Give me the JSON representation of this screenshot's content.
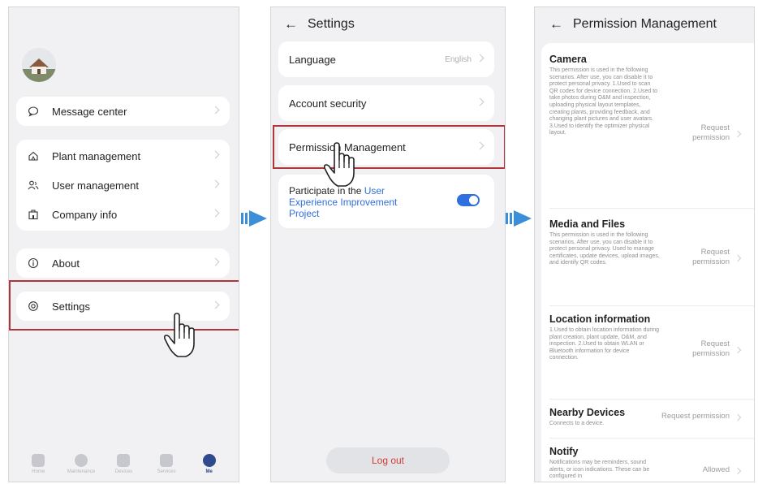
{
  "screen1": {
    "menu": [
      {
        "label": "Message center",
        "icon": "message-icon"
      },
      {
        "label": "Plant management",
        "icon": "plant-icon"
      },
      {
        "label": "User management",
        "icon": "users-icon"
      },
      {
        "label": "Company info",
        "icon": "company-icon"
      },
      {
        "label": "About",
        "icon": "info-icon"
      },
      {
        "label": "Settings",
        "icon": "settings-icon"
      }
    ],
    "tabs": [
      {
        "label": "Home"
      },
      {
        "label": "Maintenance"
      },
      {
        "label": "Devices"
      },
      {
        "label": "Services"
      },
      {
        "label": "Me",
        "active": true
      }
    ]
  },
  "screen2": {
    "title": "Settings",
    "language_label": "Language",
    "language_value": "English",
    "account_security": "Account security",
    "permission_management": "Permission Management",
    "participate_prefix": "Participate in the ",
    "participate_link": "User Experience Improvement Project",
    "toggle_on": true,
    "logout": "Log out"
  },
  "screen3": {
    "title": "Permission Management",
    "permissions": [
      {
        "title": "Camera",
        "desc": "This permission is used in the following scenarios. After use, you can disable it to protect personal privacy. 1.Used to scan QR codes for device connection. 2.Used to take photos during O&M and inspection, uploading physical layout templates, creating plants, providing feedback, and changing plant pictures and user avatars. 3.Used to identify the optimizer physical layout.",
        "action": "Request permission"
      },
      {
        "title": "Media and Files",
        "desc": "This permission is used in the following scenarios. After use, you can disable it to protect personal privacy. Used to manage certificates, update devices, upload images, and identify QR codes.",
        "action": "Request permission"
      },
      {
        "title": "Location information",
        "desc": "1.Used to obtain location information during plant creation, plant update, O&M, and inspection. 2.Used to obtain WLAN or Bluetooth information for device connection.",
        "action": "Request permission"
      },
      {
        "title": "Nearby Devices",
        "desc": "Connects to a device.",
        "action": "Request permission"
      },
      {
        "title": "Notify",
        "desc": "Notifications may be reminders, sound alerts, or icon indications. These can be configured in",
        "action": "Allowed"
      }
    ]
  },
  "colors": {
    "accent": "#2f6fe0",
    "highlight": "#b0363c",
    "arrow": "#3a8fd8",
    "logout": "#cf3d31"
  }
}
